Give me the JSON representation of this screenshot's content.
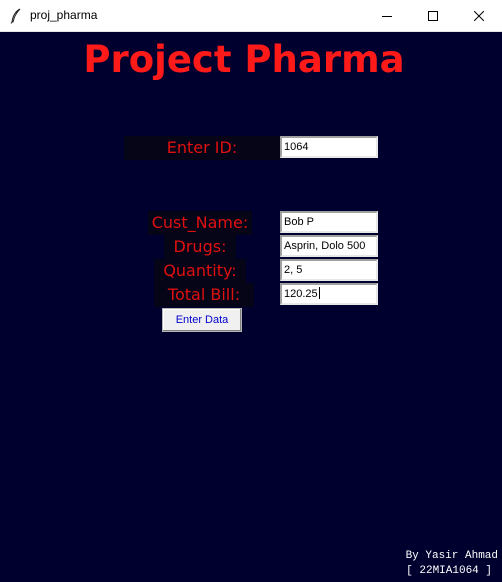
{
  "window": {
    "title": "proj_pharma",
    "controls": {
      "minimize_icon": "minimize-icon",
      "maximize_icon": "maximize-icon",
      "close_icon": "close-icon"
    }
  },
  "heading": "Project Pharma",
  "search": {
    "label": "Enter ID:",
    "value": "1064"
  },
  "form": {
    "customer_label": "Cust_Name:",
    "customer_value": "Bob P",
    "drugs_label": "Drugs:",
    "drugs_value": "Asprin, Dolo 500",
    "quantity_label": "Quantity:",
    "quantity_value": "2, 5",
    "bill_label": "Total Bill:",
    "bill_value": "120.25",
    "submit_label": "Enter Data"
  },
  "footer": {
    "credit_line1": "By Yasir Ahmad",
    "credit_line2": "[ 22MIA1064 ]"
  },
  "colors": {
    "background": "#00002e",
    "heading": "#ff1a1a",
    "label": "#e01010",
    "button_text": "#0000cc",
    "credit": "#ffffff"
  }
}
